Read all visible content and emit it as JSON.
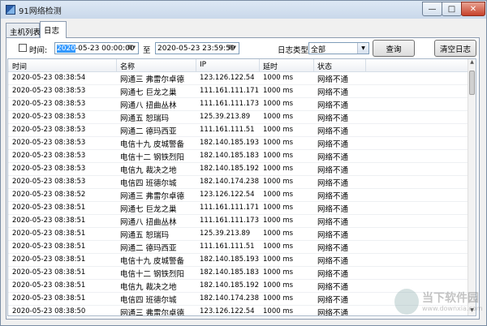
{
  "window": {
    "title": "91网络检测"
  },
  "tabs": [
    {
      "label": "主机列表"
    },
    {
      "label": "日志"
    }
  ],
  "filter": {
    "time_label": "时间:",
    "start_selected": "2020",
    "start_rest": "-05-23 00:00:00",
    "to_label": "至",
    "end_value": "2020-05-23 23:59:59",
    "type_label": "日志类型:",
    "type_value": "全部",
    "query_label": "查询",
    "clear_label": "清空日志"
  },
  "table": {
    "columns": [
      "时间",
      "名称",
      "IP",
      "延时",
      "状态"
    ],
    "rows": [
      [
        "2020-05-23 08:38:54",
        "网通三 弗雷尔卓德",
        "123.126.122.54",
        "1000 ms",
        "网络不通"
      ],
      [
        "2020-05-23 08:38:53",
        "网通七 巨龙之巢",
        "111.161.111.171",
        "1000 ms",
        "网络不通"
      ],
      [
        "2020-05-23 08:38:53",
        "网通八 扭曲丛林",
        "111.161.111.173",
        "1000 ms",
        "网络不通"
      ],
      [
        "2020-05-23 08:38:53",
        "网通五 恕瑞玛",
        "125.39.213.89",
        "1000 ms",
        "网络不通"
      ],
      [
        "2020-05-23 08:38:53",
        "网通二 德玛西亚",
        "111.161.111.51",
        "1000 ms",
        "网络不通"
      ],
      [
        "2020-05-23 08:38:53",
        "电信十九 皮城警备",
        "182.140.185.193",
        "1000 ms",
        "网络不通"
      ],
      [
        "2020-05-23 08:38:53",
        "电信十二 钢铁烈阳",
        "182.140.185.183",
        "1000 ms",
        "网络不通"
      ],
      [
        "2020-05-23 08:38:53",
        "电信九 裁决之地",
        "182.140.185.192",
        "1000 ms",
        "网络不通"
      ],
      [
        "2020-05-23 08:38:53",
        "电信四 班德尔城",
        "182.140.174.238",
        "1000 ms",
        "网络不通"
      ],
      [
        "2020-05-23 08:38:52",
        "网通三 弗雷尔卓德",
        "123.126.122.54",
        "1000 ms",
        "网络不通"
      ],
      [
        "2020-05-23 08:38:51",
        "网通七 巨龙之巢",
        "111.161.111.171",
        "1000 ms",
        "网络不通"
      ],
      [
        "2020-05-23 08:38:51",
        "网通八 扭曲丛林",
        "111.161.111.173",
        "1000 ms",
        "网络不通"
      ],
      [
        "2020-05-23 08:38:51",
        "网通五 恕瑞玛",
        "125.39.213.89",
        "1000 ms",
        "网络不通"
      ],
      [
        "2020-05-23 08:38:51",
        "网通二 德玛西亚",
        "111.161.111.51",
        "1000 ms",
        "网络不通"
      ],
      [
        "2020-05-23 08:38:51",
        "电信十九 皮城警备",
        "182.140.185.193",
        "1000 ms",
        "网络不通"
      ],
      [
        "2020-05-23 08:38:51",
        "电信十二 钢铁烈阳",
        "182.140.185.183",
        "1000 ms",
        "网络不通"
      ],
      [
        "2020-05-23 08:38:51",
        "电信九 裁决之地",
        "182.140.185.192",
        "1000 ms",
        "网络不通"
      ],
      [
        "2020-05-23 08:38:51",
        "电信四 班德尔城",
        "182.140.174.238",
        "1000 ms",
        "网络不通"
      ],
      [
        "2020-05-23 08:38:50",
        "网通三 弗雷尔卓德",
        "123.126.122.54",
        "1000 ms",
        "网络不通"
      ]
    ]
  },
  "watermark": {
    "name": "当下软件园",
    "url": "www.downxia.com"
  }
}
